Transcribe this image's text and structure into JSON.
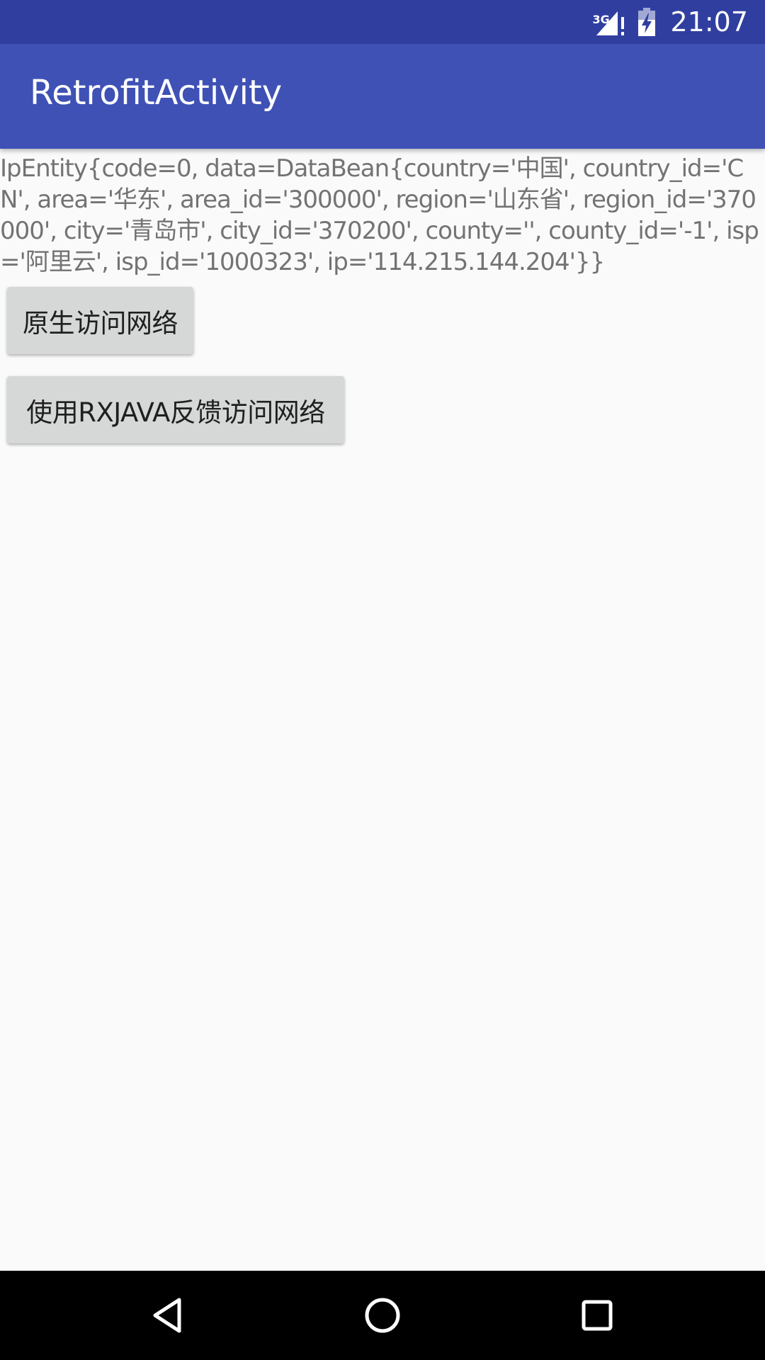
{
  "status_bar": {
    "network_type": "3G",
    "time": "21:07",
    "icons": [
      "signal-icon",
      "battery-icon"
    ]
  },
  "app_bar": {
    "title": "RetrofitActivity"
  },
  "main": {
    "response_text": "IpEntity{code=0, data=DataBean{country='中国', country_id='CN', area='华东', area_id='300000', region='山东省', region_id='370000', city='青岛市', city_id='370200', county='', county_id='-1', isp='阿里云', isp_id='1000323', ip='114.215.144.204'}}",
    "native_button_label": "原生访问网络",
    "rx_button_label": "使用RXJAVA反馈访问网络"
  },
  "nav_bar": {
    "icons": [
      "back-icon",
      "home-icon",
      "recents-icon"
    ]
  },
  "colors": {
    "status_bar": "#303f9f",
    "app_bar": "#3f51b5",
    "background": "#fafafa",
    "button": "#d6d7d7",
    "text_secondary": "#737373"
  }
}
